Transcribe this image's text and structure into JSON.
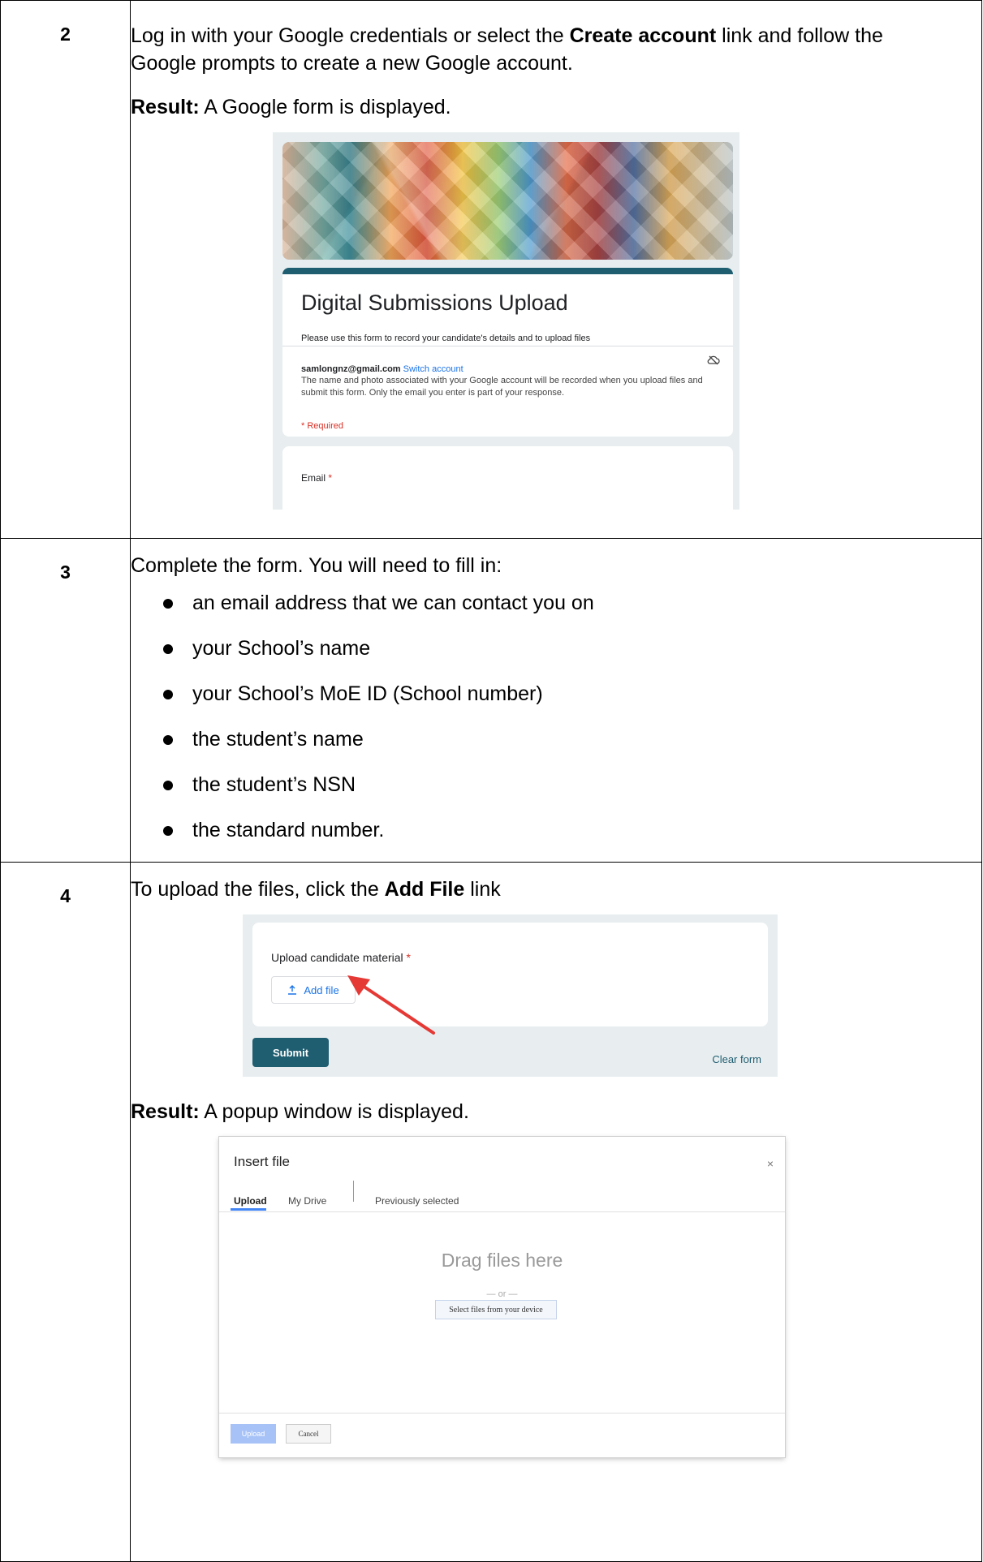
{
  "rows": [
    {
      "number": "2",
      "text_before": "Log in with your Google credentials or select the ",
      "text_bold": "Create account",
      "text_after": " link and follow the Google prompts to create a new Google account.",
      "result_label": "Result:",
      "result_text": "  A Google form is displayed."
    },
    {
      "number": "3",
      "intro": "Complete the form. You will need to fill in:",
      "items": [
        "an email address that we can contact you on",
        "your School’s name",
        "your School’s MoE ID (School number)",
        "the student’s name",
        "the student’s NSN",
        "the standard number."
      ]
    },
    {
      "number": "4",
      "text_before": "To upload the files, click the ",
      "text_bold": "Add File",
      "text_after": " link",
      "result_label": "Result:",
      "result_text": " A popup window is displayed."
    }
  ],
  "google_form": {
    "title": "Digital Submissions Upload",
    "subtitle": "Please use this form to record your candidate's details and to upload files",
    "account_email": "samlongnz@gmail.com",
    "switch_account": "Switch account",
    "note": "The name and photo associated with your Google account will be recorded when you upload files and submit this form. Only the email you enter is part of your response.",
    "required": "* Required",
    "email_label": "Email",
    "required_star": "*",
    "icon": "cloud-off-icon"
  },
  "upload_section": {
    "label": "Upload candidate material",
    "required_star": "*",
    "add_file": "Add file",
    "submit": "Submit",
    "clear_form": "Clear form",
    "accent": "#1f5d70",
    "arrow_color": "#e53935"
  },
  "insert_file_popup": {
    "title": "Insert file",
    "close": "×",
    "tabs": [
      "Upload",
      "My Drive",
      "Previously selected"
    ],
    "active_tab": "Upload",
    "drag_text": "Drag files here",
    "or_text": "— or —",
    "select_button": "Select files from your device",
    "upload_button": "Upload",
    "cancel_button": "Cancel"
  }
}
